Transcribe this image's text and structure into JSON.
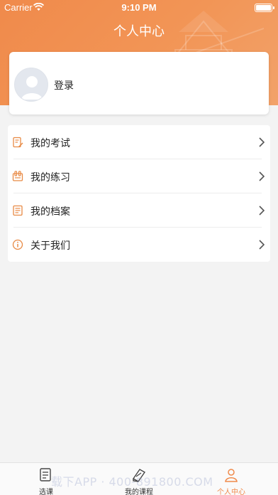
{
  "status_bar": {
    "carrier": "Carrier",
    "time": "9:10 PM"
  },
  "header": {
    "title": "个人中心"
  },
  "profile": {
    "login_label": "登录"
  },
  "menu": {
    "items": [
      {
        "label": "我的考试",
        "icon": "exam-icon"
      },
      {
        "label": "我的练习",
        "icon": "practice-icon"
      },
      {
        "label": "我的档案",
        "icon": "archive-icon"
      },
      {
        "label": "关于我们",
        "icon": "info-icon"
      }
    ]
  },
  "tab_bar": {
    "tabs": [
      {
        "label": "选课",
        "icon": "course-select-icon",
        "active": false
      },
      {
        "label": "我的课程",
        "icon": "my-courses-icon",
        "active": false
      },
      {
        "label": "个人中心",
        "icon": "profile-icon",
        "active": true
      }
    ]
  },
  "watermark": "载下APP · 400-891800.COM",
  "colors": {
    "accent": "#f08a4b",
    "background": "#f3f3f3"
  }
}
